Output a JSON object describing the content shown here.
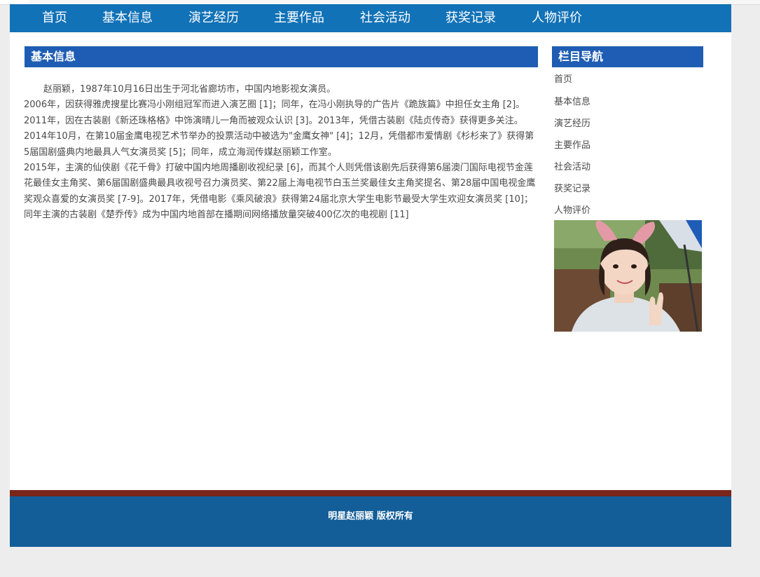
{
  "nav": {
    "items": [
      "首页",
      "基本信息",
      "演艺经历",
      "主要作品",
      "社会活动",
      "获奖记录",
      "人物评价"
    ]
  },
  "main": {
    "heading": "基本信息",
    "paragraphs": [
      "赵丽颖，1987年10月16日出生于河北省廊坊市，中国内地影视女演员。",
      "2006年，因获得雅虎搜星比赛冯小刚组冠军而进入演艺圈 [1]；同年，在冯小刚执导的广告片《跪族篇》中担任女主角 [2]。2011年，因在古装剧《新还珠格格》中饰演晴儿一角而被观众认识 [3]。2013年，凭借古装剧《陆贞传奇》获得更多关注。2014年10月，在第10届金鹰电视艺术节举办的投票活动中被选为\"金鹰女神\" [4]；12月，凭借都市爱情剧《杉杉来了》获得第5届国剧盛典内地最具人气女演员奖 [5]；同年，成立海润传媒赵丽颖工作室。",
      "2015年，主演的仙侠剧《花千骨》打破中国内地周播剧收视纪录 [6]，而其个人则凭借该剧先后获得第6届澳门国际电视节金莲花最佳女主角奖、第6届国剧盛典最具收视号召力演员奖、第22届上海电视节白玉兰奖最佳女主角奖提名、第28届中国电视金鹰奖观众喜爱的女演员奖 [7-9]。2017年，凭借电影《乘风破浪》获得第24届北京大学生电影节最受大学生欢迎女演员奖 [10]；同年主演的古装剧《楚乔传》成为中国内地首部在播期间网络播放量突破400亿次的电视剧 [11]"
    ]
  },
  "sidebar": {
    "heading": "栏目导航",
    "links": [
      "首页",
      "基本信息",
      "演艺经历",
      "主要作品",
      "社会活动",
      "获奖记录",
      "人物评价"
    ]
  },
  "footer": {
    "copyright": "明星赵丽颖 版权所有"
  },
  "colors": {
    "nav_bg": "#1272b7",
    "heading_bg": "#1e5db3",
    "footer_bg": "#135e98",
    "footer_stripe": "#7a261a",
    "page_bg": "#ededed"
  }
}
